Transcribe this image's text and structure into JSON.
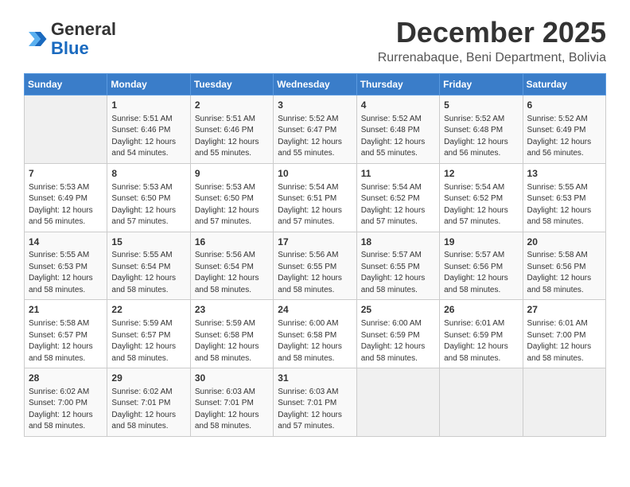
{
  "logo": {
    "line1": "General",
    "line2": "Blue"
  },
  "title": "December 2025",
  "location": "Rurrenabaque, Beni Department, Bolivia",
  "days_of_week": [
    "Sunday",
    "Monday",
    "Tuesday",
    "Wednesday",
    "Thursday",
    "Friday",
    "Saturday"
  ],
  "weeks": [
    [
      {
        "day": "",
        "empty": true,
        "content": ""
      },
      {
        "day": "1",
        "content": "Sunrise: 5:51 AM\nSunset: 6:46 PM\nDaylight: 12 hours\nand 54 minutes."
      },
      {
        "day": "2",
        "content": "Sunrise: 5:51 AM\nSunset: 6:46 PM\nDaylight: 12 hours\nand 55 minutes."
      },
      {
        "day": "3",
        "content": "Sunrise: 5:52 AM\nSunset: 6:47 PM\nDaylight: 12 hours\nand 55 minutes."
      },
      {
        "day": "4",
        "content": "Sunrise: 5:52 AM\nSunset: 6:48 PM\nDaylight: 12 hours\nand 55 minutes."
      },
      {
        "day": "5",
        "content": "Sunrise: 5:52 AM\nSunset: 6:48 PM\nDaylight: 12 hours\nand 56 minutes."
      },
      {
        "day": "6",
        "content": "Sunrise: 5:52 AM\nSunset: 6:49 PM\nDaylight: 12 hours\nand 56 minutes."
      }
    ],
    [
      {
        "day": "7",
        "content": "Sunrise: 5:53 AM\nSunset: 6:49 PM\nDaylight: 12 hours\nand 56 minutes."
      },
      {
        "day": "8",
        "content": "Sunrise: 5:53 AM\nSunset: 6:50 PM\nDaylight: 12 hours\nand 57 minutes."
      },
      {
        "day": "9",
        "content": "Sunrise: 5:53 AM\nSunset: 6:50 PM\nDaylight: 12 hours\nand 57 minutes."
      },
      {
        "day": "10",
        "content": "Sunrise: 5:54 AM\nSunset: 6:51 PM\nDaylight: 12 hours\nand 57 minutes."
      },
      {
        "day": "11",
        "content": "Sunrise: 5:54 AM\nSunset: 6:52 PM\nDaylight: 12 hours\nand 57 minutes."
      },
      {
        "day": "12",
        "content": "Sunrise: 5:54 AM\nSunset: 6:52 PM\nDaylight: 12 hours\nand 57 minutes."
      },
      {
        "day": "13",
        "content": "Sunrise: 5:55 AM\nSunset: 6:53 PM\nDaylight: 12 hours\nand 58 minutes."
      }
    ],
    [
      {
        "day": "14",
        "content": "Sunrise: 5:55 AM\nSunset: 6:53 PM\nDaylight: 12 hours\nand 58 minutes."
      },
      {
        "day": "15",
        "content": "Sunrise: 5:55 AM\nSunset: 6:54 PM\nDaylight: 12 hours\nand 58 minutes."
      },
      {
        "day": "16",
        "content": "Sunrise: 5:56 AM\nSunset: 6:54 PM\nDaylight: 12 hours\nand 58 minutes."
      },
      {
        "day": "17",
        "content": "Sunrise: 5:56 AM\nSunset: 6:55 PM\nDaylight: 12 hours\nand 58 minutes."
      },
      {
        "day": "18",
        "content": "Sunrise: 5:57 AM\nSunset: 6:55 PM\nDaylight: 12 hours\nand 58 minutes."
      },
      {
        "day": "19",
        "content": "Sunrise: 5:57 AM\nSunset: 6:56 PM\nDaylight: 12 hours\nand 58 minutes."
      },
      {
        "day": "20",
        "content": "Sunrise: 5:58 AM\nSunset: 6:56 PM\nDaylight: 12 hours\nand 58 minutes."
      }
    ],
    [
      {
        "day": "21",
        "content": "Sunrise: 5:58 AM\nSunset: 6:57 PM\nDaylight: 12 hours\nand 58 minutes."
      },
      {
        "day": "22",
        "content": "Sunrise: 5:59 AM\nSunset: 6:57 PM\nDaylight: 12 hours\nand 58 minutes."
      },
      {
        "day": "23",
        "content": "Sunrise: 5:59 AM\nSunset: 6:58 PM\nDaylight: 12 hours\nand 58 minutes."
      },
      {
        "day": "24",
        "content": "Sunrise: 6:00 AM\nSunset: 6:58 PM\nDaylight: 12 hours\nand 58 minutes."
      },
      {
        "day": "25",
        "content": "Sunrise: 6:00 AM\nSunset: 6:59 PM\nDaylight: 12 hours\nand 58 minutes."
      },
      {
        "day": "26",
        "content": "Sunrise: 6:01 AM\nSunset: 6:59 PM\nDaylight: 12 hours\nand 58 minutes."
      },
      {
        "day": "27",
        "content": "Sunrise: 6:01 AM\nSunset: 7:00 PM\nDaylight: 12 hours\nand 58 minutes."
      }
    ],
    [
      {
        "day": "28",
        "content": "Sunrise: 6:02 AM\nSunset: 7:00 PM\nDaylight: 12 hours\nand 58 minutes."
      },
      {
        "day": "29",
        "content": "Sunrise: 6:02 AM\nSunset: 7:01 PM\nDaylight: 12 hours\nand 58 minutes."
      },
      {
        "day": "30",
        "content": "Sunrise: 6:03 AM\nSunset: 7:01 PM\nDaylight: 12 hours\nand 58 minutes."
      },
      {
        "day": "31",
        "content": "Sunrise: 6:03 AM\nSunset: 7:01 PM\nDaylight: 12 hours\nand 57 minutes."
      },
      {
        "day": "",
        "empty": true,
        "content": ""
      },
      {
        "day": "",
        "empty": true,
        "content": ""
      },
      {
        "day": "",
        "empty": true,
        "content": ""
      }
    ]
  ]
}
